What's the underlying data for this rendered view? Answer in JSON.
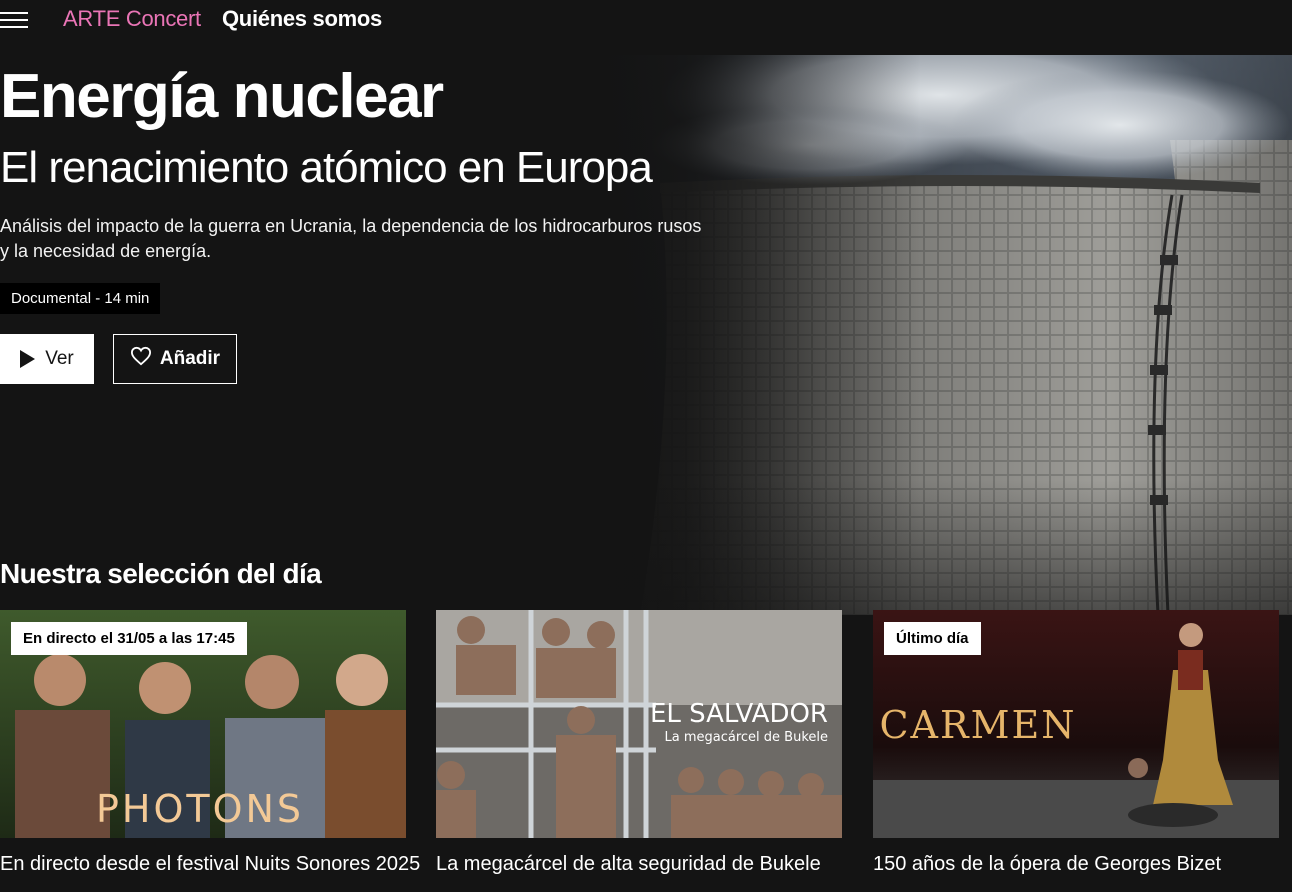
{
  "nav": {
    "menu_icon": "hamburger-menu-icon",
    "arte_concert": "ARTE Concert",
    "about": "Quiénes somos",
    "accent_color": "#ea75b6"
  },
  "hero": {
    "title": "Energía nuclear",
    "subtitle": "El renacimiento atómico en Europa",
    "description": "Análisis del impacto de la guerra en Ucrania, la dependencia de los hidrocarburos rusos y la necesidad de energía.",
    "meta": "Documental - 14 min",
    "play_label": "Ver",
    "add_label": "Añadir",
    "play_icon": "play-icon",
    "add_icon": "heart-icon"
  },
  "selection": {
    "title": "Nuestra selección del día",
    "cards": [
      {
        "badge": "En directo el 31/05 a las 17:45",
        "thumb_text": "PHOTONS",
        "caption": "En directo desde el festival Nuits Sonores 2025"
      },
      {
        "badge": "",
        "thumb_text": "EL SALVADOR",
        "thumb_subtext": "La megacárcel de Bukele",
        "caption": "La megacárcel de alta seguridad de Bukele"
      },
      {
        "badge": "Último día",
        "thumb_text": "CARMEN",
        "caption": "150 años de la ópera de Georges Bizet"
      }
    ]
  }
}
